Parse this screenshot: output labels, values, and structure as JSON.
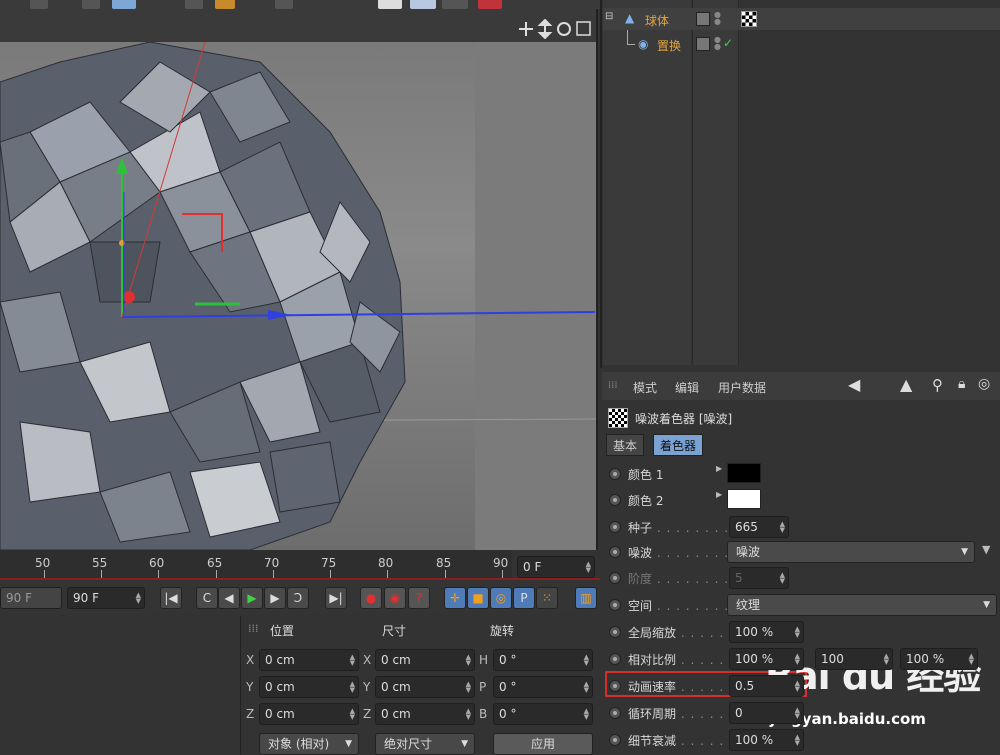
{
  "viewport": {
    "menu_icons": [
      "move-icon",
      "drag-icon",
      "rotate-icon",
      "fullscreen-icon"
    ]
  },
  "timeline": {
    "ticks": [
      "50",
      "55",
      "60",
      "65",
      "70",
      "75",
      "80",
      "85",
      "90"
    ],
    "current_frame": "0 F",
    "preview_max": "90 F",
    "end_frame": "90 F"
  },
  "coords": {
    "header_position": "位置",
    "header_size": "尺寸",
    "header_rotation": "旋转",
    "pos": {
      "x_label": "X",
      "y_label": "Y",
      "z_label": "Z",
      "x": "0 cm",
      "y": "0 cm",
      "z": "0 cm"
    },
    "size": {
      "x_label": "X",
      "y_label": "Y",
      "z_label": "Z",
      "x": "0 cm",
      "y": "0 cm",
      "z": "0 cm"
    },
    "rot": {
      "h_label": "H",
      "p_label": "P",
      "b_label": "B",
      "h": "0 °",
      "p": "0 °",
      "b": "0 °"
    },
    "mode_dropdown": "对象 (相对)",
    "size_dropdown": "绝对尺寸",
    "apply_button": "应用"
  },
  "objects": {
    "items": [
      {
        "name": "球体",
        "color": "#e3a33a"
      },
      {
        "name": "置换",
        "color": "#e3a33a"
      }
    ]
  },
  "attributes": {
    "menu": [
      "模式",
      "编辑",
      "用户数据"
    ],
    "title": "噪波着色器 [噪波]",
    "tabs": [
      "基本",
      "着色器"
    ],
    "rows": {
      "color1": {
        "label": "颜色 1",
        "dots": "",
        "value": ""
      },
      "color2": {
        "label": "颜色 2",
        "dots": "",
        "value": ""
      },
      "seed": {
        "label": "种子",
        "dots": ". . . . . . . . .",
        "value": "665"
      },
      "noise": {
        "label": "噪波",
        "dots": ". . . . . . . . .",
        "value": "噪波"
      },
      "octaves": {
        "label": "阶度",
        "dots": ". . . . . . . . .",
        "value": "5"
      },
      "space": {
        "label": "空间",
        "dots": ". . . . . . . . .",
        "value": "纹理"
      },
      "global_scale": {
        "label": "全局缩放",
        "dots": ". . . . . .",
        "value": "100 %"
      },
      "relative_scale": {
        "label": "相对比例",
        "dots": ". . . . . .",
        "value": "100 %",
        "value2": "100",
        "value3": "100 %"
      },
      "anim_speed": {
        "label": "动画速率",
        "dots": ". . . . . .",
        "value": "0.5"
      },
      "loop_period": {
        "label": "循环周期",
        "dots": ". . . . . .",
        "value": "0"
      },
      "detail_atten": {
        "label": "细节衰减",
        "dots": ". . . . . .",
        "value": "100 %"
      }
    },
    "color_black": "#000000",
    "color_white": "#ffffff",
    "highlight_color": "#d62d2d"
  },
  "watermark": {
    "brand": "Bai du 经验",
    "url": "jingyan.baidu.com"
  }
}
